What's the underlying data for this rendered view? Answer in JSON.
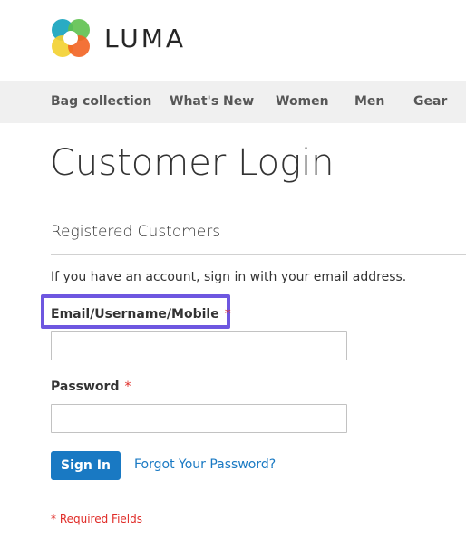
{
  "brand": {
    "name": "LUMA",
    "logo_icon": "luma-logo-icon",
    "colors": {
      "blue": "#1979c3",
      "orange": "#f26322",
      "green": "#5ec14f",
      "yellow": "#f3d02f",
      "teal": "#1da7c0"
    }
  },
  "nav": {
    "items": [
      {
        "label": "Bag collection"
      },
      {
        "label": "What's New"
      },
      {
        "label": "Women"
      },
      {
        "label": "Men"
      },
      {
        "label": "Gear"
      }
    ]
  },
  "page": {
    "title": "Customer Login"
  },
  "login": {
    "block_title": "Registered Customers",
    "intro": "If you have an account, sign in with your email address.",
    "email_label": "Email/Username/Mobile",
    "email_value": "",
    "password_label": "Password",
    "password_value": "",
    "required_mark": "*",
    "sign_in_label": "Sign In",
    "forgot_label": "Forgot Your Password?",
    "required_note": "* Required Fields"
  },
  "accent": {
    "highlight_color": "#6e57e0",
    "required_color": "#e02b27"
  }
}
